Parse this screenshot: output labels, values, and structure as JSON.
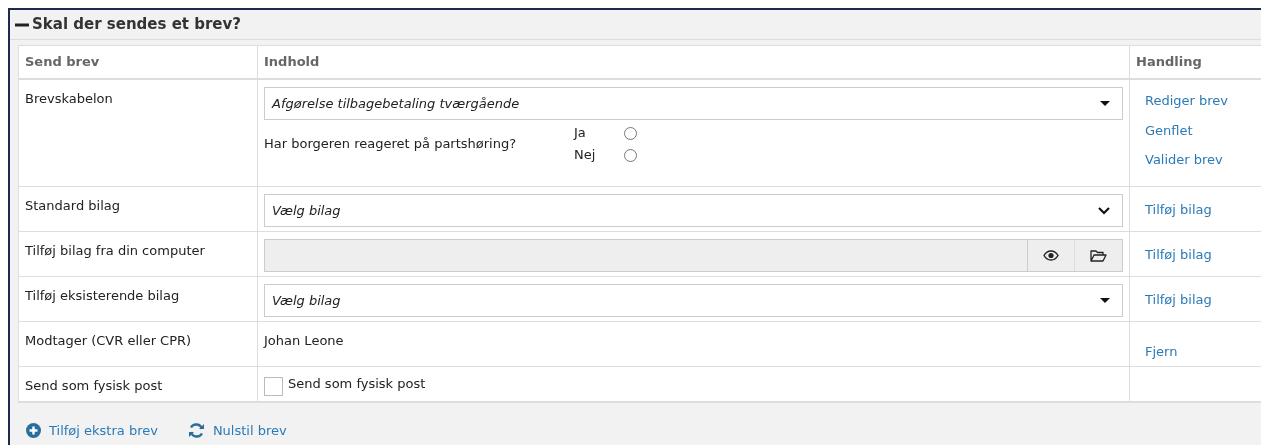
{
  "panel": {
    "title": "Skal der sendes et brev?",
    "expanded": true
  },
  "table": {
    "columns": [
      "Send brev",
      "Indhold",
      "Handling"
    ],
    "rows": [
      {
        "label": "Brevskabelon",
        "content": {
          "kind": "dropdown",
          "value": "Afgørelse tilbagebetaling tværgående",
          "question": "Har borgeren reageret på partshøring?",
          "options": [
            {
              "label": "Ja",
              "selected": false
            },
            {
              "label": "Nej",
              "selected": false
            }
          ]
        },
        "actions": [
          "Rediger brev",
          "Genflet",
          "Valider brev"
        ]
      },
      {
        "label": "Standard bilag",
        "content": {
          "kind": "select",
          "value": "Vælg bilag"
        },
        "actions": [
          "Tilføj bilag"
        ]
      },
      {
        "label": "Tilføj bilag fra din computer",
        "content": {
          "kind": "file"
        },
        "actions": [
          "Tilføj bilag"
        ]
      },
      {
        "label": "Tilføj eksisterende bilag",
        "content": {
          "kind": "dropdown",
          "value": "Vælg bilag"
        },
        "actions": [
          "Tilføj bilag"
        ]
      },
      {
        "label": "Modtager (CVR eller CPR)",
        "content": {
          "kind": "text",
          "value": "Johan Leone"
        },
        "actions": [
          "Fjern"
        ]
      },
      {
        "label": "Send som fysisk post",
        "content": {
          "kind": "checkbox",
          "label": "Send som fysisk post",
          "checked": false
        },
        "actions": []
      }
    ]
  },
  "footer_links": [
    {
      "kind": "add",
      "label": "Tilføj ekstra brev"
    },
    {
      "kind": "reset",
      "label": "Nulstil brev"
    }
  ]
}
